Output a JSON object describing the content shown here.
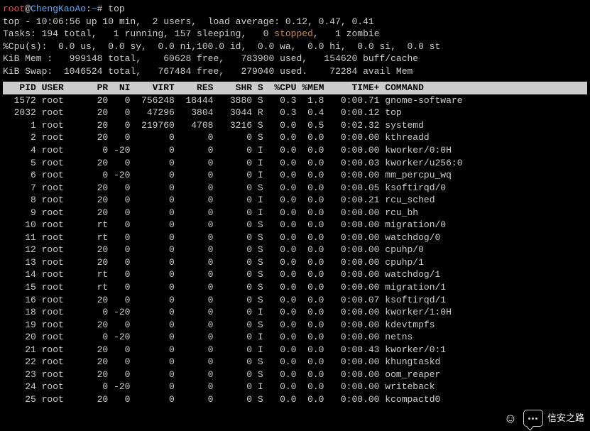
{
  "prompt": {
    "user": "root",
    "at": "@",
    "host": "ChengKaoAo",
    "path": "~",
    "symbol": "#",
    "command": "top"
  },
  "summary": {
    "line1": "top - 10:06:56 up 10 min,  2 users,  load average: 0.12, 0.47, 0.41",
    "line2a": "Tasks: 194 total,   1 running, 157 sleeping,   0 ",
    "line2b": "stopped",
    "line2c": ",   1 zombie",
    "line3": "%Cpu(s):  0.0 us,  0.0 sy,  0.0 ni,100.0 id,  0.0 wa,  0.0 hi,  0.0 si,  0.0 st",
    "line4": "KiB Mem :   999148 total,    60628 free,   783900 used,   154620 buff/cache",
    "line5": "KiB Swap:  1046524 total,   767484 free,   279040 used.    72284 avail Mem"
  },
  "header": "   PID USER      PR  NI    VIRT    RES    SHR S  %CPU %MEM     TIME+ COMMAND        ",
  "rows": [
    {
      "pid": "1572",
      "user": "root",
      "pr": "20",
      "ni": "0",
      "virt": "756248",
      "res": "18444",
      "shr": "3880",
      "s": "S",
      "cpu": "0.3",
      "mem": "1.8",
      "time": "0:00.71",
      "cmd": "gnome-software"
    },
    {
      "pid": "2032",
      "user": "root",
      "pr": "20",
      "ni": "0",
      "virt": "47296",
      "res": "3804",
      "shr": "3044",
      "s": "R",
      "cpu": "0.3",
      "mem": "0.4",
      "time": "0:00.12",
      "cmd": "top"
    },
    {
      "pid": "1",
      "user": "root",
      "pr": "20",
      "ni": "0",
      "virt": "219760",
      "res": "4708",
      "shr": "3216",
      "s": "S",
      "cpu": "0.0",
      "mem": "0.5",
      "time": "0:02.32",
      "cmd": "systemd"
    },
    {
      "pid": "2",
      "user": "root",
      "pr": "20",
      "ni": "0",
      "virt": "0",
      "res": "0",
      "shr": "0",
      "s": "S",
      "cpu": "0.0",
      "mem": "0.0",
      "time": "0:00.00",
      "cmd": "kthreadd"
    },
    {
      "pid": "4",
      "user": "root",
      "pr": "0",
      "ni": "-20",
      "virt": "0",
      "res": "0",
      "shr": "0",
      "s": "I",
      "cpu": "0.0",
      "mem": "0.0",
      "time": "0:00.00",
      "cmd": "kworker/0:0H"
    },
    {
      "pid": "5",
      "user": "root",
      "pr": "20",
      "ni": "0",
      "virt": "0",
      "res": "0",
      "shr": "0",
      "s": "I",
      "cpu": "0.0",
      "mem": "0.0",
      "time": "0:00.03",
      "cmd": "kworker/u256:0"
    },
    {
      "pid": "6",
      "user": "root",
      "pr": "0",
      "ni": "-20",
      "virt": "0",
      "res": "0",
      "shr": "0",
      "s": "I",
      "cpu": "0.0",
      "mem": "0.0",
      "time": "0:00.00",
      "cmd": "mm_percpu_wq"
    },
    {
      "pid": "7",
      "user": "root",
      "pr": "20",
      "ni": "0",
      "virt": "0",
      "res": "0",
      "shr": "0",
      "s": "S",
      "cpu": "0.0",
      "mem": "0.0",
      "time": "0:00.05",
      "cmd": "ksoftirqd/0"
    },
    {
      "pid": "8",
      "user": "root",
      "pr": "20",
      "ni": "0",
      "virt": "0",
      "res": "0",
      "shr": "0",
      "s": "I",
      "cpu": "0.0",
      "mem": "0.0",
      "time": "0:00.21",
      "cmd": "rcu_sched"
    },
    {
      "pid": "9",
      "user": "root",
      "pr": "20",
      "ni": "0",
      "virt": "0",
      "res": "0",
      "shr": "0",
      "s": "I",
      "cpu": "0.0",
      "mem": "0.0",
      "time": "0:00.00",
      "cmd": "rcu_bh"
    },
    {
      "pid": "10",
      "user": "root",
      "pr": "rt",
      "ni": "0",
      "virt": "0",
      "res": "0",
      "shr": "0",
      "s": "S",
      "cpu": "0.0",
      "mem": "0.0",
      "time": "0:00.00",
      "cmd": "migration/0"
    },
    {
      "pid": "11",
      "user": "root",
      "pr": "rt",
      "ni": "0",
      "virt": "0",
      "res": "0",
      "shr": "0",
      "s": "S",
      "cpu": "0.0",
      "mem": "0.0",
      "time": "0:00.00",
      "cmd": "watchdog/0"
    },
    {
      "pid": "12",
      "user": "root",
      "pr": "20",
      "ni": "0",
      "virt": "0",
      "res": "0",
      "shr": "0",
      "s": "S",
      "cpu": "0.0",
      "mem": "0.0",
      "time": "0:00.00",
      "cmd": "cpuhp/0"
    },
    {
      "pid": "13",
      "user": "root",
      "pr": "20",
      "ni": "0",
      "virt": "0",
      "res": "0",
      "shr": "0",
      "s": "S",
      "cpu": "0.0",
      "mem": "0.0",
      "time": "0:00.00",
      "cmd": "cpuhp/1"
    },
    {
      "pid": "14",
      "user": "root",
      "pr": "rt",
      "ni": "0",
      "virt": "0",
      "res": "0",
      "shr": "0",
      "s": "S",
      "cpu": "0.0",
      "mem": "0.0",
      "time": "0:00.00",
      "cmd": "watchdog/1"
    },
    {
      "pid": "15",
      "user": "root",
      "pr": "rt",
      "ni": "0",
      "virt": "0",
      "res": "0",
      "shr": "0",
      "s": "S",
      "cpu": "0.0",
      "mem": "0.0",
      "time": "0:00.00",
      "cmd": "migration/1"
    },
    {
      "pid": "16",
      "user": "root",
      "pr": "20",
      "ni": "0",
      "virt": "0",
      "res": "0",
      "shr": "0",
      "s": "S",
      "cpu": "0.0",
      "mem": "0.0",
      "time": "0:00.07",
      "cmd": "ksoftirqd/1"
    },
    {
      "pid": "18",
      "user": "root",
      "pr": "0",
      "ni": "-20",
      "virt": "0",
      "res": "0",
      "shr": "0",
      "s": "I",
      "cpu": "0.0",
      "mem": "0.0",
      "time": "0:00.00",
      "cmd": "kworker/1:0H"
    },
    {
      "pid": "19",
      "user": "root",
      "pr": "20",
      "ni": "0",
      "virt": "0",
      "res": "0",
      "shr": "0",
      "s": "S",
      "cpu": "0.0",
      "mem": "0.0",
      "time": "0:00.00",
      "cmd": "kdevtmpfs"
    },
    {
      "pid": "20",
      "user": "root",
      "pr": "0",
      "ni": "-20",
      "virt": "0",
      "res": "0",
      "shr": "0",
      "s": "I",
      "cpu": "0.0",
      "mem": "0.0",
      "time": "0:00.00",
      "cmd": "netns"
    },
    {
      "pid": "21",
      "user": "root",
      "pr": "20",
      "ni": "0",
      "virt": "0",
      "res": "0",
      "shr": "0",
      "s": "I",
      "cpu": "0.0",
      "mem": "0.0",
      "time": "0:00.43",
      "cmd": "kworker/0:1"
    },
    {
      "pid": "22",
      "user": "root",
      "pr": "20",
      "ni": "0",
      "virt": "0",
      "res": "0",
      "shr": "0",
      "s": "S",
      "cpu": "0.0",
      "mem": "0.0",
      "time": "0:00.00",
      "cmd": "khungtaskd"
    },
    {
      "pid": "23",
      "user": "root",
      "pr": "20",
      "ni": "0",
      "virt": "0",
      "res": "0",
      "shr": "0",
      "s": "S",
      "cpu": "0.0",
      "mem": "0.0",
      "time": "0:00.00",
      "cmd": "oom_reaper"
    },
    {
      "pid": "24",
      "user": "root",
      "pr": "0",
      "ni": "-20",
      "virt": "0",
      "res": "0",
      "shr": "0",
      "s": "I",
      "cpu": "0.0",
      "mem": "0.0",
      "time": "0:00.00",
      "cmd": "writeback"
    },
    {
      "pid": "25",
      "user": "root",
      "pr": "20",
      "ni": "0",
      "virt": "0",
      "res": "0",
      "shr": "0",
      "s": "S",
      "cpu": "0.0",
      "mem": "0.0",
      "time": "0:00.00",
      "cmd": "kcompactd0"
    }
  ],
  "overlay": {
    "channel_name": "信安之路"
  }
}
